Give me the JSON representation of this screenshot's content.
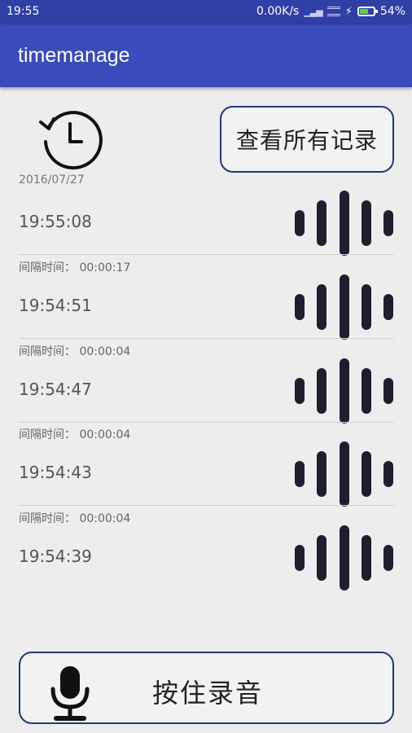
{
  "status_bar": {
    "time": "19:55",
    "network_speed": "0.00K/s",
    "battery_percent": "54%",
    "battery_level": 0.54,
    "icons": [
      "signal-icon",
      "wifi-icon",
      "charging-bolt-icon",
      "battery-icon"
    ]
  },
  "app_bar": {
    "title": "timemanage"
  },
  "header": {
    "history_icon": "history-clock-icon",
    "view_all_label": "查看所有记录"
  },
  "date": "2016/07/27",
  "records": [
    {
      "time": "19:55:08",
      "interval": ""
    },
    {
      "time": "19:54:51",
      "interval": "间隔时间： 00:00:17"
    },
    {
      "time": "19:54:47",
      "interval": "间隔时间： 00:00:04"
    },
    {
      "time": "19:54:43",
      "interval": "间隔时间： 00:00:04"
    },
    {
      "time": "19:54:39",
      "interval": "间隔时间： 00:00:04"
    }
  ],
  "record_button": {
    "label": "按住录音",
    "icon": "microphone-icon"
  },
  "colors": {
    "status_bar": "#2f3fa6",
    "app_bar": "#3a4cba",
    "accent_border": "#1e3a78",
    "waveform": "#1e1e2e",
    "battery_fill": "#5ad04a"
  }
}
